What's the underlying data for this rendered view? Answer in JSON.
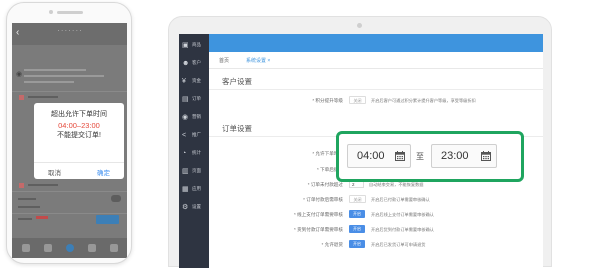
{
  "phone": {
    "back": "‹",
    "title": "· · · · · · ·",
    "dialog": {
      "line1": "超出允许下单时间",
      "line2": "04:00–23:00",
      "line3": "不能提交订单!",
      "cancel": "取消",
      "confirm": "确定"
    }
  },
  "admin": {
    "sidebar": [
      {
        "icon": "▣",
        "name": "shop-icon",
        "label": "商品"
      },
      {
        "icon": "☻",
        "name": "customer-icon",
        "label": "客户"
      },
      {
        "icon": "¥",
        "name": "yen-icon",
        "label": "资金"
      },
      {
        "icon": "▤",
        "name": "order-icon",
        "label": "订单"
      },
      {
        "icon": "◉",
        "name": "marketing-icon",
        "label": "营销"
      },
      {
        "icon": "<",
        "name": "share-icon",
        "label": "推广"
      },
      {
        "icon": "◔",
        "name": "stats-icon",
        "label": "统计"
      },
      {
        "icon": "▥",
        "name": "page-icon",
        "label": "页面"
      },
      {
        "icon": "▦",
        "name": "app-icon",
        "label": "应用"
      },
      {
        "icon": "⚙",
        "name": "settings-icon",
        "label": "设置"
      }
    ],
    "tabs": {
      "home": "首页",
      "settings": "系统设置 ×"
    },
    "customer_section": "客户设置",
    "order_section": "订单设置",
    "fields": {
      "points_label": "* 积分提升等级",
      "points_toggle": "关闭",
      "points_hint": "开启后客户可通过积分累计提升客户等级，享受等级折扣",
      "allow_time_label": "* 允许下单时间",
      "order_notice_label": "* 下单后提醒",
      "auto_cancel_label": "* 订单未付款超过",
      "auto_cancel_value": "2",
      "auto_cancel_hint": "自动结束交易，不能恢复数据",
      "audit_label": "* 订单付款后需审核",
      "audit_toggle": "关闭",
      "audit_hint": "开启后已付款订单需要审核确认",
      "offline_audit_label": "* 线上支付订单需要审核",
      "offline_audit_toggle": "开启",
      "offline_audit_hint": "开启后线上支付订单需要审核确认",
      "reach_audit_label": "* 货到付款订单需要审核",
      "reach_audit_toggle": "开启",
      "reach_audit_hint": "开启后货到付款订单需要审核确认",
      "allow_ship_label": "* 允许退货",
      "allow_ship_toggle": "开启",
      "allow_ship_hint": "开启后已发货订单可申请退货"
    },
    "time_range": {
      "start": "04:00",
      "separator": "至",
      "end": "23:00"
    }
  },
  "colors": {
    "primary": "#3e94de",
    "sidebar": "#2e3441",
    "highlight": "#1fa55f",
    "danger": "#e54a3c"
  }
}
